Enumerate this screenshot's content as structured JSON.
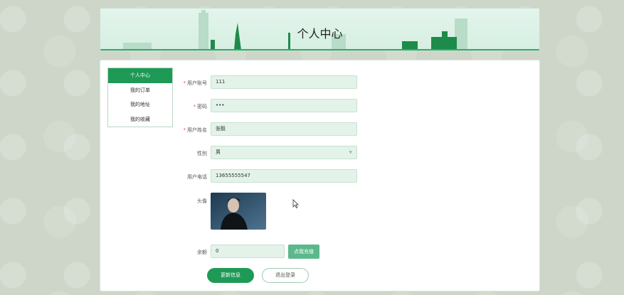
{
  "header": {
    "title": "个人中心"
  },
  "menu": {
    "items": [
      {
        "label": "个人中心",
        "active": true
      },
      {
        "label": "我的订单",
        "active": false
      },
      {
        "label": "我的地址",
        "active": false
      },
      {
        "label": "我的收藏",
        "active": false
      }
    ]
  },
  "form": {
    "account": {
      "label": "用户账号",
      "value": "111",
      "required": "*"
    },
    "password": {
      "label": "密码",
      "value": "•••",
      "required": "*"
    },
    "name": {
      "label": "用户姓名",
      "value": "张毅",
      "required": "*"
    },
    "gender": {
      "label": "性别",
      "value": "男"
    },
    "phone": {
      "label": "用户电话",
      "value": "13655555547"
    },
    "avatar": {
      "label": "头像"
    },
    "balance": {
      "label": "余额",
      "value": "0"
    }
  },
  "buttons": {
    "recharge": "点我充值",
    "update": "更新信息",
    "logout": "退出登录"
  },
  "colors": {
    "accent": "#1f9a56",
    "input_bg": "#e3f3e9",
    "banner_bg": "#d6efe2"
  },
  "icons": {
    "cursor": "pointer-cursor-icon",
    "select": "chevron-down-icon"
  }
}
